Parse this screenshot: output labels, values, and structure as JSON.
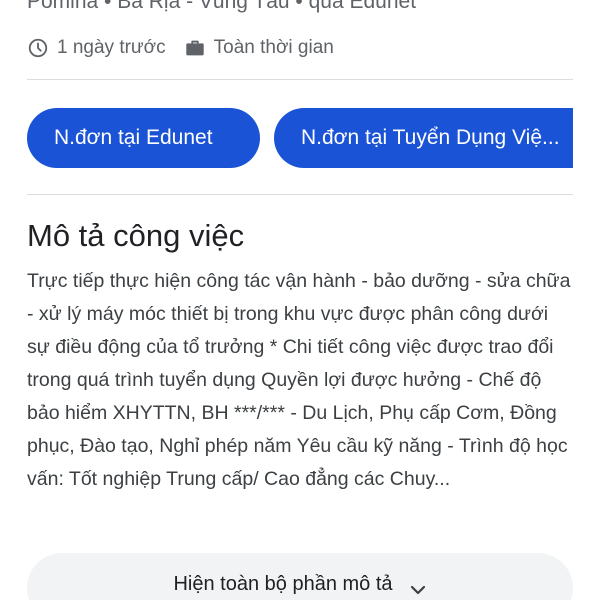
{
  "job": {
    "subtitle": "Pomina • Bà Rịa - Vũng Tàu • qua Edunet",
    "posted": "1 ngày trước",
    "job_type": "Toàn thời gian"
  },
  "apply_buttons": [
    {
      "label": "N.đơn tại Edunet"
    },
    {
      "label": "N.đơn tại Tuyển Dụng Việ..."
    }
  ],
  "description": {
    "title": "Mô tả công việc",
    "text": "Trực tiếp thực hiện công tác vận hành - bảo dưỡng - sửa chữa - xử lý máy móc thiết bị trong khu vực được phân công dưới sự điều động của tổ trưởng * Chi tiết công việc được trao đổi trong quá trình tuyển dụng Quyền lợi được hưởng - Chế độ bảo hiểm XHYTTN, BH ***/*** - Du Lịch, Phụ cấp Cơm, Đồng phục, Đào tạo, Nghỉ phép năm Yêu cầu kỹ năng - Trình độ học vấn: Tốt nghiệp Trung cấp/ Cao đẳng các Chuy...",
    "expand_label": "Hiện toàn bộ phần mô tả"
  },
  "icons": {
    "posted": "clock-icon",
    "job_type": "briefcase-icon",
    "expand": "chevron-down-icon"
  },
  "colors": {
    "apply_button_bg": "#1a53d6",
    "expand_button_bg": "#f1f3f4",
    "secondary_text": "#5f6368"
  }
}
